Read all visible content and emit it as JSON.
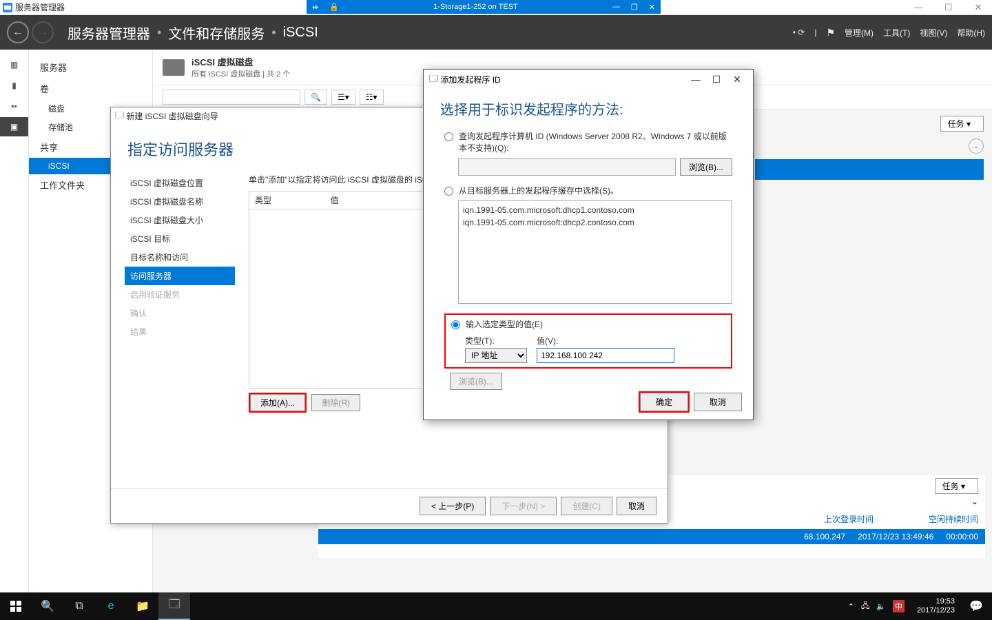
{
  "outer": {
    "title": "服务器管理器",
    "win_min": "—",
    "win_max": "☐",
    "win_close": "✕"
  },
  "remote": {
    "title": "1-Storage1-252 on TEST",
    "pin": "⇹",
    "lock": "🔒",
    "min": "—",
    "max": "❐",
    "close": "✕"
  },
  "toolbar": {
    "crumb1": "服务器管理器",
    "crumb2": "文件和存储服务",
    "crumb3": "iSCSI",
    "menu_manage": "管理(M)",
    "menu_tools": "工具(T)",
    "menu_view": "视图(V)",
    "menu_help": "帮助(H)"
  },
  "nav": {
    "servers": "服务器",
    "volumes": "卷",
    "disks": "磁盘",
    "pools": "存储池",
    "shares": "共享",
    "iscsi": "iSCSI",
    "workfolders": "工作文件夹"
  },
  "section": {
    "title": "iSCSI 虚拟磁盘",
    "subtitle": "所有 iSCSI 虚拟磁盘 | 共 2 个",
    "tasks": "任务"
  },
  "rightinfo": {
    "tasks": "任务",
    "col1": "上次登录时间",
    "col2": "空闲持续时间",
    "ip": "68.100.247",
    "time": "2017/12/23 13:49:46",
    "idle": "00:00:00"
  },
  "wizard": {
    "title": "新建 iSCSI 虚拟磁盘向导",
    "heading": "指定访问服务器",
    "steps": {
      "loc": "iSCSI 虚拟磁盘位置",
      "name": "iSCSI 虚拟磁盘名称",
      "size": "iSCSI 虚拟磁盘大小",
      "target": "iSCSI 目标",
      "tname": "目标名称和访问",
      "access": "访问服务器",
      "auth": "启用验证服务",
      "confirm": "确认",
      "result": "结果"
    },
    "instr": "单击\"添加\"以指定将访问此 iSCSI 虚拟磁盘的 iSC",
    "col_type": "类型",
    "col_value": "值",
    "btn_add": "添加(A)...",
    "btn_remove": "删除(R)",
    "btn_prev": "< 上一步(P)",
    "btn_next": "下一步(N) >",
    "btn_create": "创建(C)",
    "btn_cancel": "取消"
  },
  "dlg": {
    "title": "添加发起程序 ID",
    "heading": "选择用于标识发起程序的方法:",
    "opt1": "查询发起程序计算机 ID (Windows Server 2008 R2、Windows 7 或以前版本不支持)(Q):",
    "browse": "浏览(B)...",
    "opt2": "从目标服务器上的发起程序缓存中选择(S)。",
    "cache": [
      "iqn.1991-05.com.microsoft:dhcp1.contoso.com",
      "iqn.1991-05.com.microsoft:dhcp2.contoso.com"
    ],
    "opt3": "输入选定类型的值(E)",
    "type_label": "类型(T):",
    "value_label": "值(V):",
    "type_selected": "IP 地址",
    "value_input": "192.168.100.242",
    "browse2": "浏览(B)...",
    "ok": "确定",
    "cancel": "取消"
  },
  "taskbar": {
    "time": "19:53",
    "date": "2017/12/23",
    "ime": "中"
  }
}
